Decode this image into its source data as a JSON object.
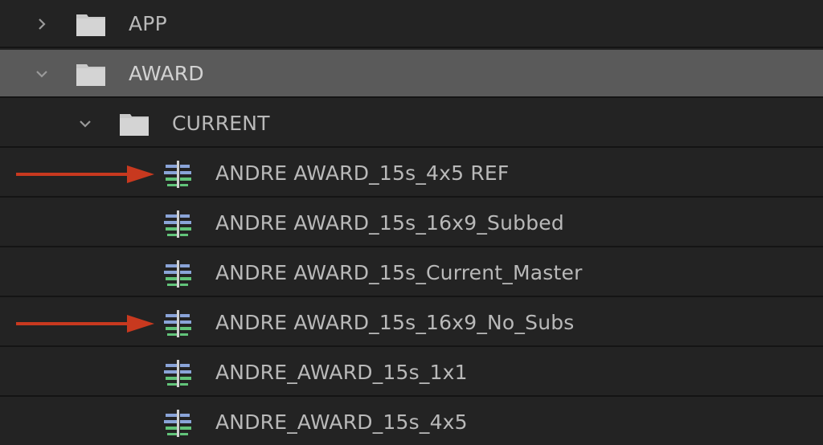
{
  "project_panel": {
    "items": [
      {
        "type": "bin",
        "label": "APP",
        "expanded": false,
        "selected": false,
        "depth": 0,
        "icon": "folder-icon"
      },
      {
        "type": "bin",
        "label": "AWARD",
        "expanded": true,
        "selected": true,
        "depth": 0,
        "icon": "folder-icon"
      },
      {
        "type": "bin",
        "label": "CURRENT",
        "expanded": true,
        "selected": false,
        "depth": 1,
        "icon": "folder-icon"
      },
      {
        "type": "sequence",
        "label": "ANDRE AWARD_15s_4x5 REF",
        "icon": "sequence-icon",
        "annotated": true
      },
      {
        "type": "sequence",
        "label": "ANDRE AWARD_15s_16x9_Subbed",
        "icon": "sequence-icon",
        "annotated": false
      },
      {
        "type": "sequence",
        "label": "ANDRE AWARD_15s_Current_Master",
        "icon": "sequence-icon",
        "annotated": false
      },
      {
        "type": "sequence",
        "label": "ANDRE AWARD_15s_16x9_No_Subs",
        "icon": "sequence-icon",
        "annotated": true
      },
      {
        "type": "sequence",
        "label": "ANDRE_AWARD_15s_1x1",
        "icon": "sequence-icon",
        "annotated": false
      },
      {
        "type": "sequence",
        "label": "ANDRE_AWARD_15s_4x5",
        "icon": "sequence-icon",
        "annotated": false
      }
    ]
  },
  "colors": {
    "background": "#232323",
    "selected_row": "#5a5a5a",
    "annotation_arrow": "#c8391f",
    "sequence_icon_blue": "#8aa4d8",
    "sequence_icon_green": "#62c47a"
  }
}
